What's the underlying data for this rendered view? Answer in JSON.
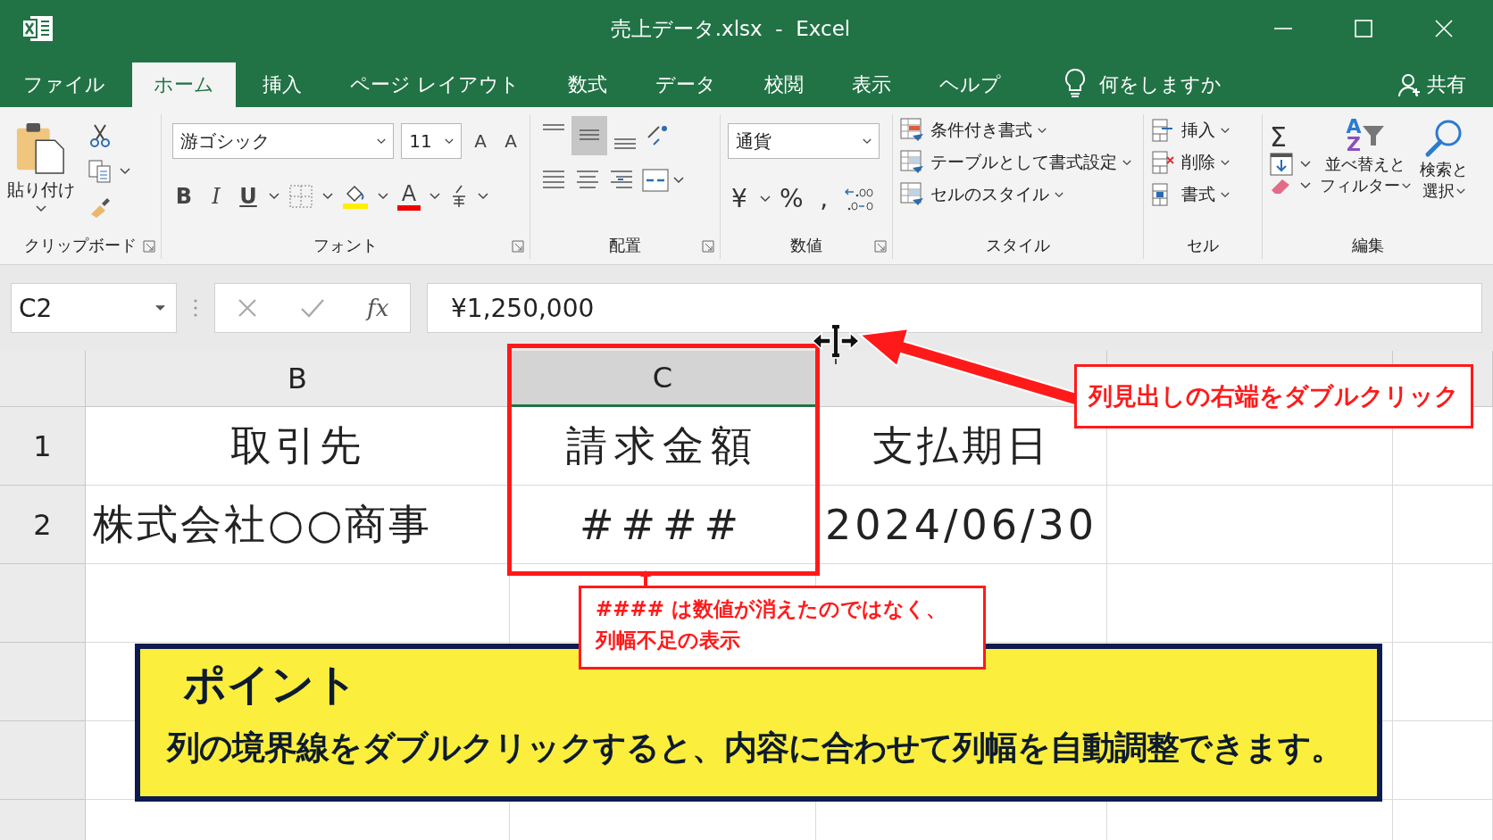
{
  "window": {
    "title": "売上データ.xlsx  -  Excel"
  },
  "tabs": [
    {
      "label": "ファイル",
      "selected": false
    },
    {
      "label": "ホーム",
      "selected": true
    },
    {
      "label": "挿入",
      "selected": false
    },
    {
      "label": "ページ レイアウト",
      "selected": false
    },
    {
      "label": "数式",
      "selected": false
    },
    {
      "label": "データ",
      "selected": false
    },
    {
      "label": "校閲",
      "selected": false
    },
    {
      "label": "表示",
      "selected": false
    },
    {
      "label": "ヘルプ",
      "selected": false
    }
  ],
  "tell_me": "何をしますか",
  "share": "共有",
  "ribbon": {
    "clipboard": {
      "paste": "貼り付け",
      "label": "クリップボード"
    },
    "font": {
      "name": "游ゴシック",
      "size": "11",
      "size_buttons": [
        "A",
        "A"
      ],
      "style_buttons": [
        "B",
        "I",
        "U"
      ],
      "color_button": "A",
      "label": "フォント"
    },
    "alignment": {
      "middle_align_on": true,
      "label": "配置"
    },
    "number": {
      "format": "通貨",
      "buttons": [
        "¥",
        "%",
        ","
      ],
      "label": "数値"
    },
    "styles": {
      "items": [
        "条件付き書式",
        "テーブルとして書式設定",
        "セルのスタイル"
      ],
      "label": "スタイル"
    },
    "cells": {
      "items": [
        "挿入",
        "削除",
        "書式"
      ],
      "label": "セル"
    },
    "editing": {
      "sum": "Σ",
      "sort_letters": [
        "A",
        "Z"
      ],
      "sort": [
        "並べ替えと",
        "フィルター"
      ],
      "find": [
        "検索と",
        "選択"
      ],
      "label": "編集"
    }
  },
  "formula_bar": {
    "name_box": "C2",
    "function_label": "fx",
    "formula": "¥1,250,000"
  },
  "sheet": {
    "columns": [
      {
        "header": "B",
        "selected": false
      },
      {
        "header": "C",
        "selected": true
      }
    ],
    "rows": [
      {
        "header": "1",
        "cells": [
          "取引先",
          "請求金額",
          "支払期日"
        ]
      },
      {
        "header": "2",
        "cells": [
          "株式会社○○商事",
          "####",
          "2024/06/30"
        ]
      }
    ]
  },
  "header_callout": "列見出しの右端をダブルクリック",
  "cell_callout": [
    "#### は数値が消えたのではなく、",
    "列幅不足の表示"
  ],
  "point": {
    "title": "ポイント",
    "text": "列の境界線をダブルクリックすると、内容に合わせて列幅を自動調整できます。"
  }
}
